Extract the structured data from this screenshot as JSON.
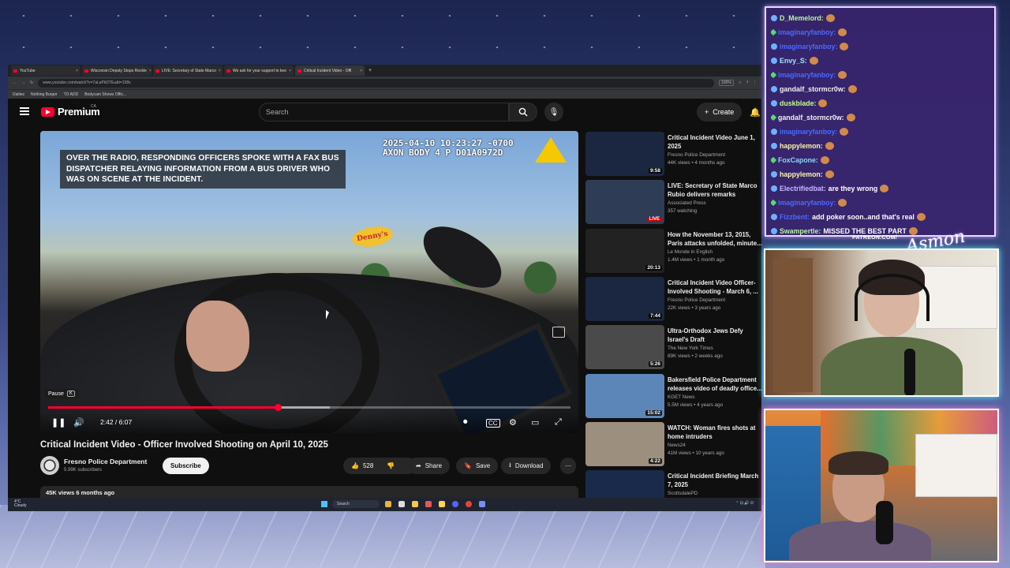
{
  "browser": {
    "tabs": [
      {
        "label": "YouTube",
        "active": false
      },
      {
        "label": "Wisconsin Deputy Stops Reckle",
        "active": false
      },
      {
        "label": "LIVE: Secretary of State Marco",
        "active": false
      },
      {
        "label": "We ask for your support to kee",
        "active": false
      },
      {
        "label": "Critical Incident Video - Offi",
        "active": true
      }
    ],
    "new_tab": "+",
    "url": "www.youtube.com/watch?v=7aLaPkDTEu&t=158s",
    "zoom": "100%",
    "bookmarks": [
      "Dailies",
      "Nothing Burger",
      "TO ADD",
      "Bodycam Shows Offic..."
    ]
  },
  "youtube": {
    "logo_text": "Premium",
    "logo_region": "CA",
    "search_placeholder": "Search",
    "create_label": "Create"
  },
  "player": {
    "caption": "OVER THE RADIO, RESPONDING OFFICERS SPOKE WITH A FAX BUS DISPATCHER RELAYING INFORMATION FROM A BUS DRIVER WHO WAS ON SCENE AT THE INCIDENT.",
    "timestamp_line1": "2025-04-10 10:23:27 -0700",
    "timestamp_line2": "AXON BODY 4 P D01A0972D",
    "sign_text": "Denny's",
    "tooltip_label": "Pause",
    "tooltip_key": "K",
    "time_display": "2:42 / 6:07",
    "progress_fraction": 0.44,
    "buffer_fraction": 0.54
  },
  "video": {
    "title": "Critical Incident Video - Officer Involved Shooting on April 10, 2025",
    "channel_name": "Fresno Police Department",
    "subscribers": "5.99K subscribers",
    "subscribe_label": "Subscribe",
    "likes": "528",
    "share_label": "Share",
    "save_label": "Save",
    "download_label": "Download",
    "views_line": "45K views  6 months ago"
  },
  "recommendations": [
    {
      "title": "Critical Incident Video June 1, 2025",
      "channel": "Fresno Police Department",
      "meta": "44K views • 4 months ago",
      "duration": "9:58",
      "live": false,
      "thumb_color": "#1b2740"
    },
    {
      "title": "LIVE: Secretary of State Marco Rubio delivers remarks",
      "channel": "Associated Press",
      "meta": "357 watching",
      "duration": "LIVE",
      "live": true,
      "thumb_color": "#2f3c55"
    },
    {
      "title": "How the November 13, 2015, Paris attacks unfolded, minute...",
      "channel": "Le Monde in English",
      "meta": "1.4M views • 1 month ago",
      "duration": "20:13",
      "live": false,
      "thumb_color": "#222"
    },
    {
      "title": "Critical Incident Video Officer-Involved Shooting - March 6, ...",
      "channel": "Fresno Police Department",
      "meta": "22K views • 3 years ago",
      "duration": "7:44",
      "live": false,
      "thumb_color": "#1b2740"
    },
    {
      "title": "Ultra-Orthodox Jews Defy Israel's Draft",
      "channel": "The New York Times",
      "meta": "89K views • 2 weeks ago",
      "duration": "5:26",
      "live": false,
      "thumb_color": "#4a4a4a"
    },
    {
      "title": "Bakersfield Police Department releases video of deadly office...",
      "channel": "KGET News",
      "meta": "5.5M views • 4 years ago",
      "duration": "15:02",
      "live": false,
      "thumb_color": "#5d86b8"
    },
    {
      "title": "WATCH: Woman fires shots at home intruders",
      "channel": "News24",
      "meta": "41M views • 10 years ago",
      "duration": "4:22",
      "live": false,
      "thumb_color": "#9c8f7e"
    },
    {
      "title": "Critical Incident Briefing March 7, 2025",
      "channel": "ScottsdalePD",
      "meta": "",
      "duration": "",
      "live": false,
      "thumb_color": "#1a2a4a"
    }
  ],
  "taskbar": {
    "weather_temp": "4°C",
    "weather_desc": "Cloudy",
    "search_label": "Search"
  },
  "chat": {
    "messages": [
      {
        "user": "D_Memelord:",
        "text": "",
        "color": "#b9f0a6"
      },
      {
        "user": "imaginaryfanboy:",
        "text": "",
        "color": "#4a6bff"
      },
      {
        "user": "imaginaryfanboy:",
        "text": "",
        "color": "#4a6bff"
      },
      {
        "user": "Envy_S:",
        "text": "",
        "color": "#9ee7ff"
      },
      {
        "user": "imaginaryfanboy:",
        "text": "",
        "color": "#4a6bff"
      },
      {
        "user": "gandalf_stormcr0w:",
        "text": "",
        "color": "#f0f0f0"
      },
      {
        "user": "duskblade:",
        "text": "",
        "color": "#c7ff8a"
      },
      {
        "user": "gandalf_stormcr0w:",
        "text": "",
        "color": "#f0f0f0"
      },
      {
        "user": "imaginaryfanboy:",
        "text": "",
        "color": "#4a6bff"
      },
      {
        "user": "happylemon:",
        "text": "",
        "color": "#fff6a6"
      },
      {
        "user": "FoxCapone:",
        "text": "",
        "color": "#8ad7ff"
      },
      {
        "user": "happylemon:",
        "text": "",
        "color": "#fff6a6"
      },
      {
        "user": "Electrifiedbat:",
        "text": "are they wrong",
        "color": "#c9b6ff"
      },
      {
        "user": "imaginaryfanboy:",
        "text": "",
        "color": "#4a6bff"
      },
      {
        "user": "Fizzbent:",
        "text": "add poker soon..and that's real",
        "color": "#4a6bff"
      },
      {
        "user": "Swampertle:",
        "text": "MISSED THE BEST PART",
        "color": "#b9f0a6"
      }
    ]
  },
  "overlay": {
    "patreon": "PATREON.COM/",
    "signature": "Asmongold"
  },
  "colors": {
    "accent_red": "#ff0033",
    "bg_dark": "#0f0f0f",
    "chat_bg": "#38246e"
  }
}
